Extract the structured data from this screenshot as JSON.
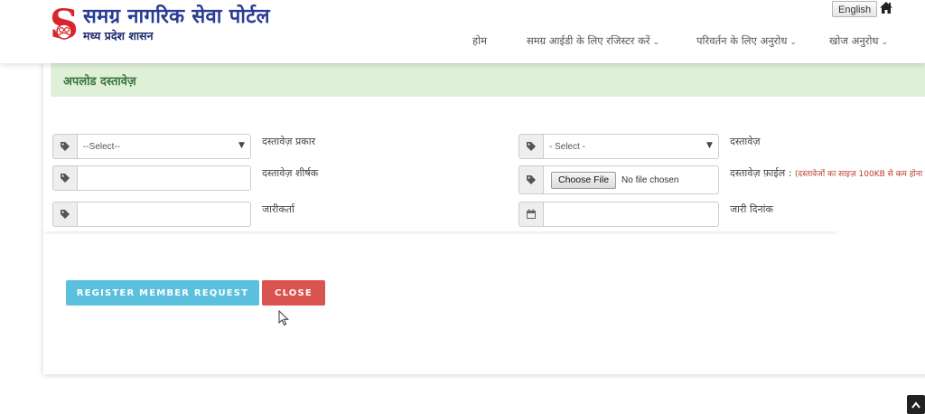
{
  "header": {
    "logo_letter": "S",
    "title": "समग्र नागरिक सेवा पोर्टल",
    "subtitle": "मध्य प्रदेश शासन",
    "language_button": "English",
    "nav": [
      {
        "label": "होम",
        "has_dropdown": false
      },
      {
        "label": "समग्र आईडी के लिए रजिस्टर करें",
        "has_dropdown": true
      },
      {
        "label": "परिवर्तन के लिए अनुरोध",
        "has_dropdown": true
      },
      {
        "label": "खोज अनुरोध",
        "has_dropdown": true
      }
    ],
    "dropdown_glyph": "⌄"
  },
  "panel": {
    "title": "अपलोड दस्तावेज़"
  },
  "form": {
    "document_type": {
      "label": "दस्तावेज़ प्रकार",
      "value": "--Select--"
    },
    "document_title": {
      "label": "दस्तावेज़ शीर्षक",
      "value": ""
    },
    "issuer": {
      "label": "जारीकर्ता",
      "value": ""
    },
    "document": {
      "label": "दस्तावेज़",
      "value": "- Select -"
    },
    "document_file": {
      "label": "दस्तावेज़ फ़ाईल :",
      "note": "(दस्तावेजों का साइज़ 100KB से कम होना",
      "button": "Choose File",
      "status": "No file chosen"
    },
    "issue_date": {
      "label": "जारी दिनांक",
      "value": ""
    }
  },
  "buttons": {
    "register": "REGISTER MEMBER REQUEST",
    "close": "CLOSE"
  },
  "colors": {
    "brand_blue": "#2a3c93",
    "logo_red": "#d9242b",
    "panel_heading_bg": "#dff0d8",
    "panel_heading_text": "#3c763d",
    "info_button": "#5bc0de",
    "danger_button": "#d9534f",
    "note_text": "#c0392b"
  },
  "icons": {
    "addon_fields": "tag-icon",
    "date_field": "calendar-icon",
    "home": "home-icon",
    "scroll": "chevron-up-icon"
  }
}
